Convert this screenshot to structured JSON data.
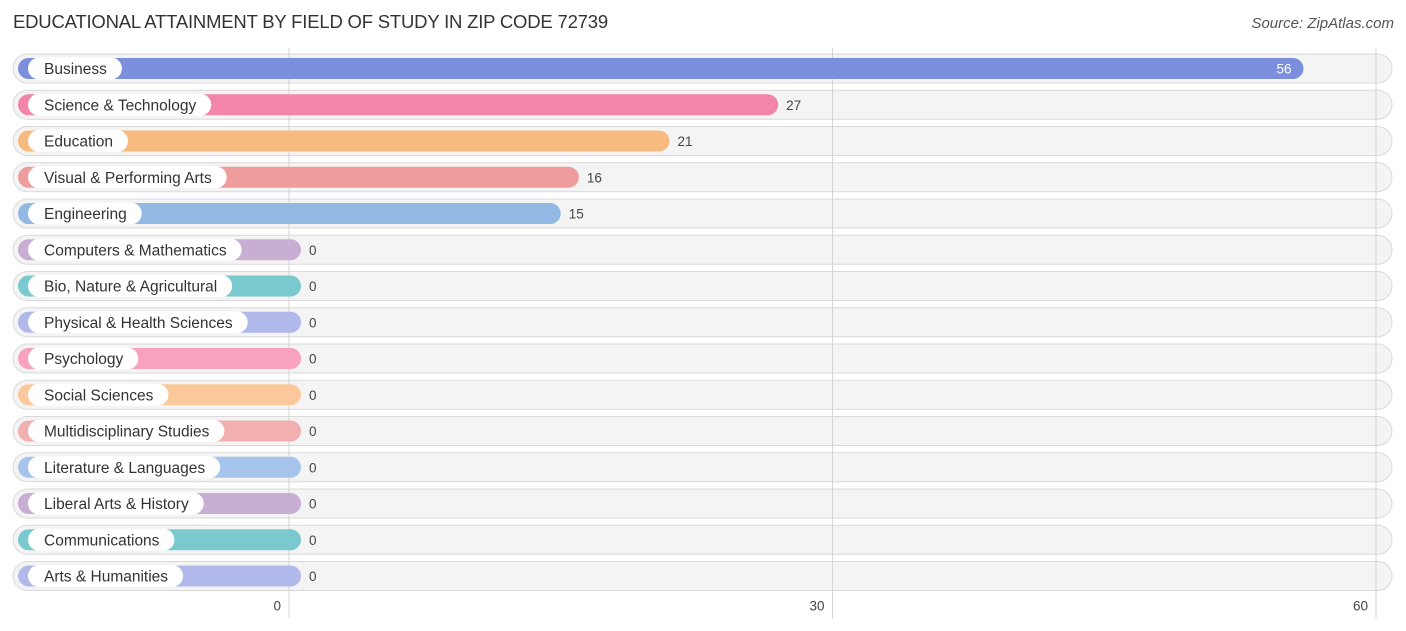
{
  "header": {
    "title": "EDUCATIONAL ATTAINMENT BY FIELD OF STUDY IN ZIP CODE 72739",
    "source": "Source: ZipAtlas.com"
  },
  "chart_data": {
    "type": "bar",
    "orientation": "horizontal",
    "title": "EDUCATIONAL ATTAINMENT BY FIELD OF STUDY IN ZIP CODE 72739",
    "xlabel": "",
    "ylabel": "",
    "xlim": [
      0,
      60
    ],
    "xticks": [
      0,
      30,
      60
    ],
    "grid": true,
    "categories": [
      "Business",
      "Science & Technology",
      "Education",
      "Visual & Performing Arts",
      "Engineering",
      "Computers & Mathematics",
      "Bio, Nature & Agricultural",
      "Physical & Health Sciences",
      "Psychology",
      "Social Sciences",
      "Multidisciplinary Studies",
      "Literature & Languages",
      "Liberal Arts & History",
      "Communications",
      "Arts & Humanities"
    ],
    "values": [
      56,
      27,
      21,
      16,
      15,
      0,
      0,
      0,
      0,
      0,
      0,
      0,
      0,
      0,
      0
    ],
    "colors": [
      "#7b8fdc",
      "#f285a8",
      "#f8bb7f",
      "#ee9c9c",
      "#92b8e4",
      "#c9aed3",
      "#79c9cf",
      "#b1b9ea",
      "#f8a2bf",
      "#fac89a",
      "#f2afaf",
      "#a6c4ec",
      "#c9aed3",
      "#79c9cf",
      "#b1b9ea"
    ]
  }
}
